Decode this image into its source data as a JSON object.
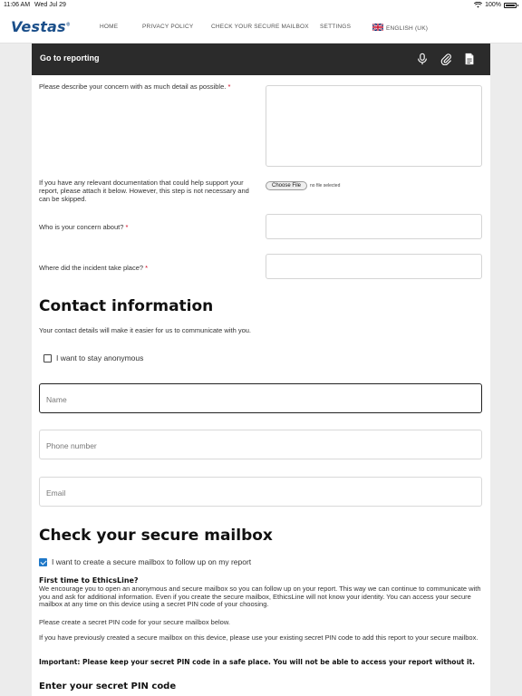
{
  "status": {
    "time": "11:06 AM",
    "date": "Wed Jul 29",
    "battery": "100%"
  },
  "nav": {
    "logo": "Vestas",
    "items": [
      "HOME",
      "PRIVACY POLICY",
      "CHECK YOUR SECURE MAILBOX",
      "SETTINGS"
    ],
    "language": "ENGLISH (UK)"
  },
  "header": {
    "title": "Go to reporting",
    "icons": [
      "microphone-icon",
      "paperclip-icon",
      "document-icon"
    ]
  },
  "form": {
    "describe_label": "Please describe your concern with as much detail as possible.",
    "docs_label": "If you have any relevant documentation that could help support your report, please attach it below. However, this step is not necessary and can be skipped.",
    "file_button": "Choose File",
    "file_status": "no file selected",
    "who_label": "Who is your concern about?",
    "where_label": "Where did the incident take place?",
    "required_mark": "*"
  },
  "contact": {
    "heading": "Contact information",
    "intro": "Your contact details will make it easier for us to communicate with you.",
    "anonymous_label": "I want to stay anonymous",
    "anonymous_checked": false,
    "name_placeholder": "Name",
    "phone_placeholder": "Phone number",
    "email_placeholder": "Email"
  },
  "mailbox": {
    "heading": "Check your secure mailbox",
    "create_label": "I want to create a secure mailbox to follow up on my report",
    "create_checked": true,
    "first_time_title": "First time to EthicsLine?",
    "first_time_text": "We encourage you to open an anonymous and secure mailbox so you can follow up on your report. This way we can continue to communicate with you and ask for additional information. Even if you create the secure mailbox, EthicsLine will not know your identity. You can access your secure mailbox at any time on this device using a secret PIN code of your choosing.",
    "create_pin_text": "Please create a secret PIN code for your secure mailbox below.",
    "existing_text": "If you have previously created a secure mailbox on this device, please use your existing secret PIN code to add this report to your secure mailbox.",
    "important_text": "Important: Please keep your secret PIN code in a safe place. You will not be able to access your report without it.",
    "pin_heading": "Enter your secret PIN code"
  },
  "colors": {
    "brand": "#1b4f8a",
    "header_bg": "#2b2b2b",
    "required": "#d0021b",
    "check": "#1f78c8"
  }
}
